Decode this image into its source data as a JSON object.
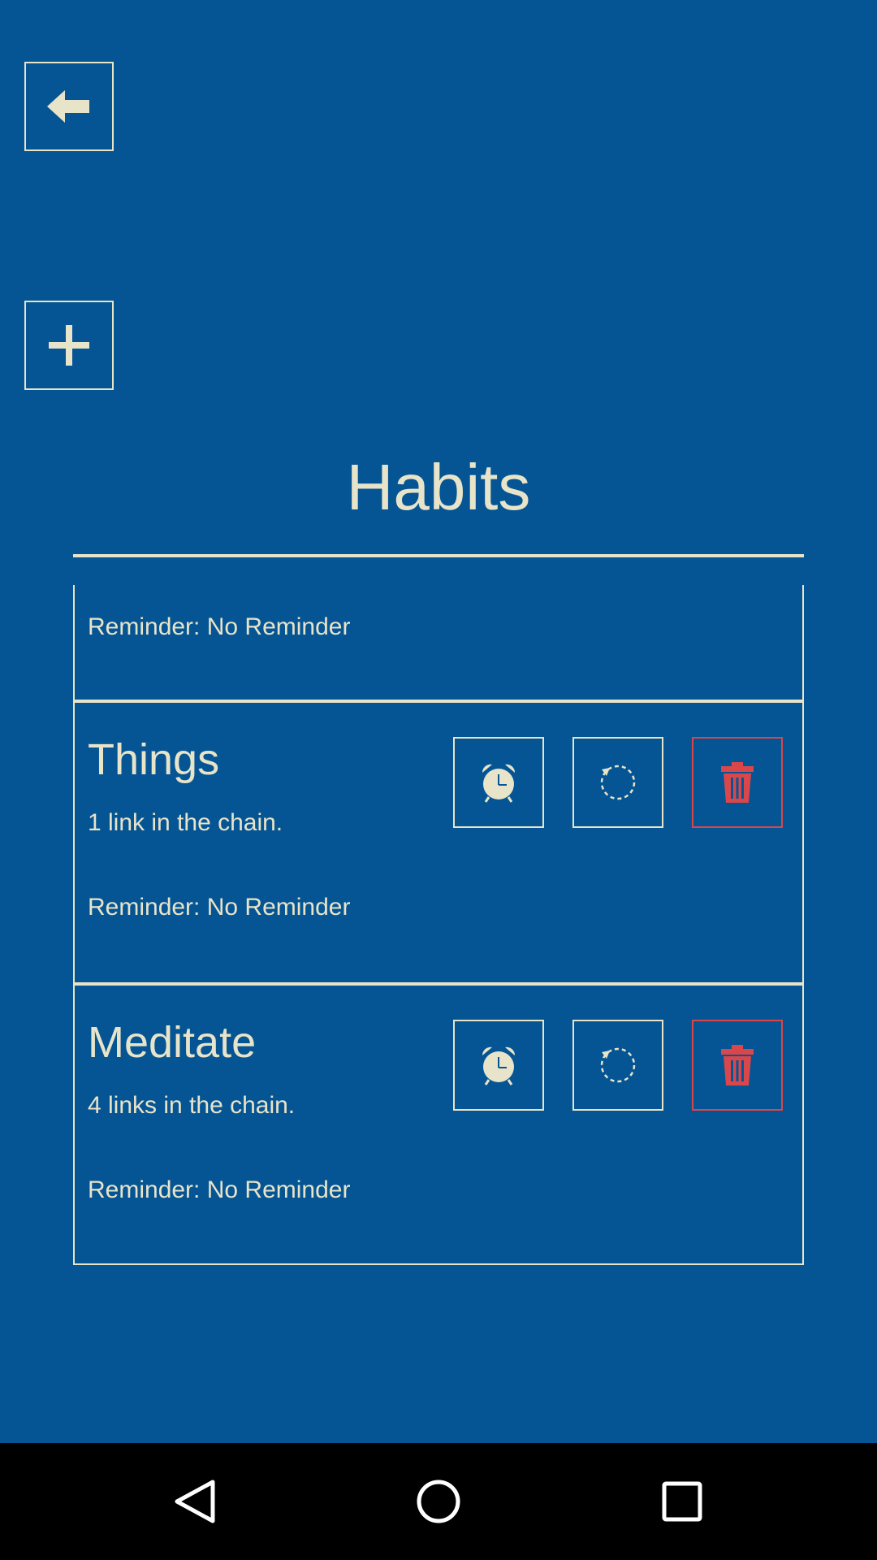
{
  "header": {
    "back_icon": "arrow-left-icon",
    "add_icon": "plus-icon",
    "title": "Habits"
  },
  "colors": {
    "background": "#055594",
    "foreground": "#e8e4c9",
    "danger": "#d9474b",
    "navbar": "#000000"
  },
  "habits": [
    {
      "name": "",
      "links": "",
      "reminder": "Reminder: No Reminder"
    },
    {
      "name": "Things",
      "links": "1 link in the chain.",
      "reminder": "Reminder: No Reminder"
    },
    {
      "name": "Meditate",
      "links": "4 links in the chain.",
      "reminder": "Reminder: No Reminder"
    }
  ],
  "actions": {
    "alarm_icon": "alarm-clock-icon",
    "reset_icon": "reset-circle-icon",
    "delete_icon": "trash-icon"
  },
  "navbar": {
    "back_icon": "nav-back-triangle-icon",
    "home_icon": "nav-home-circle-icon",
    "recent_icon": "nav-recent-square-icon"
  }
}
